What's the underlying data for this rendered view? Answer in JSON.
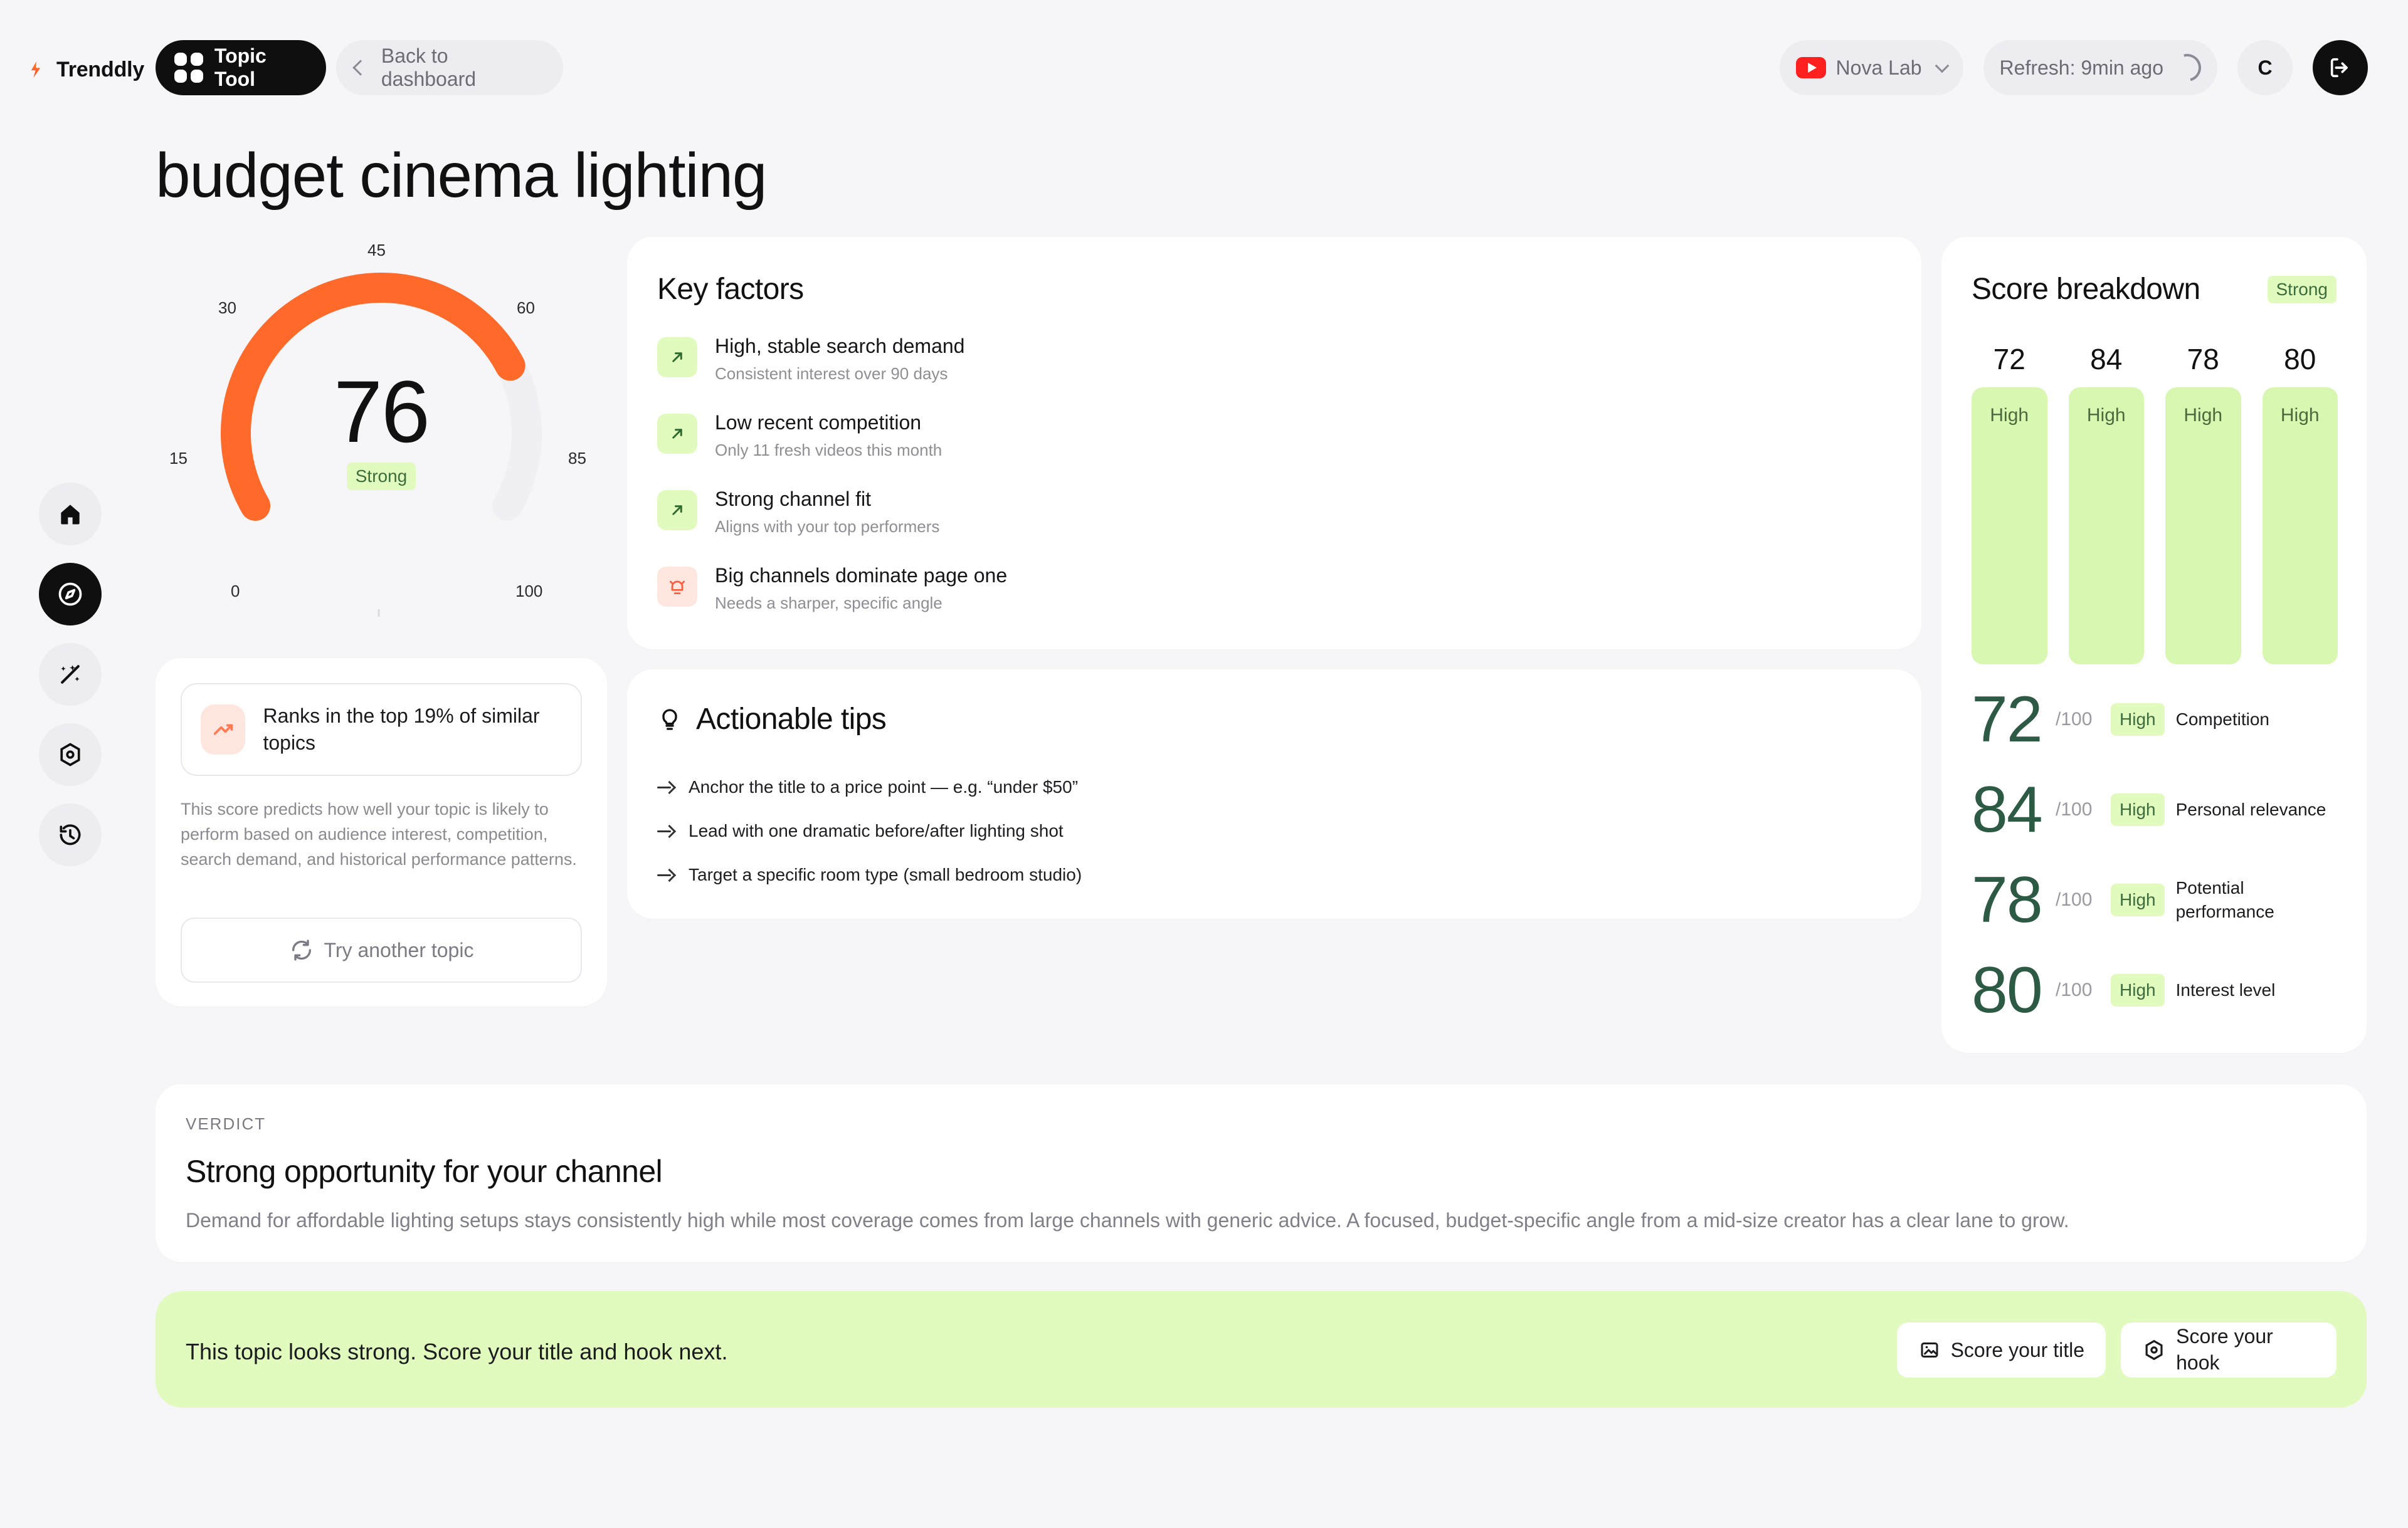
{
  "topbar": {
    "brand": "Trenddly",
    "tool_label": "Topic Tool",
    "back_label": "Back to dashboard",
    "channel": "Nova Lab",
    "refresh": "Refresh: 9min ago",
    "avatar_initial": "C"
  },
  "page": {
    "title": "budget cinema lighting"
  },
  "gauge": {
    "value": 76,
    "badge": "Strong",
    "ticks": [
      "0",
      "15",
      "30",
      "45",
      "60",
      "85",
      "100"
    ],
    "accent": "#ff6a2b"
  },
  "rank": {
    "headline": "Ranks in the top 19% of similar topics",
    "description": "This score predicts how well your topic is likely to perform based on audience interest, competition, search demand, and historical performance patterns.",
    "button": "Try another topic"
  },
  "key_factors": {
    "title": "Key factors",
    "items": [
      {
        "title": "High, stable search demand",
        "subtitle": "Consistent interest over 90 days",
        "icon": "arrow-up-right-icon",
        "tone": "green"
      },
      {
        "title": "Low recent competition",
        "subtitle": "Only 11 fresh videos this month",
        "icon": "arrow-up-right-icon",
        "tone": "green"
      },
      {
        "title": "Strong channel fit",
        "subtitle": "Aligns with your top performers",
        "icon": "arrow-up-right-icon",
        "tone": "green"
      },
      {
        "title": "Big channels dominate page one",
        "subtitle": "Needs a sharper, specific angle",
        "icon": "alarm-icon",
        "tone": "red"
      }
    ]
  },
  "tips": {
    "title": "Actionable tips",
    "items": [
      "Anchor the title to a price point — e.g. “under $50”",
      "Lead with one dramatic before/after lighting shot",
      "Target a specific room type (small bedroom studio)"
    ]
  },
  "score_breakdown": {
    "title": "Score breakdown",
    "badge": "Strong",
    "bars": [
      {
        "value": "72",
        "level": "High"
      },
      {
        "value": "84",
        "level": "High"
      },
      {
        "value": "78",
        "level": "High"
      },
      {
        "value": "80",
        "level": "High"
      }
    ],
    "rows": [
      {
        "value": "72",
        "out_of": "/100",
        "level": "High",
        "label": "Competition"
      },
      {
        "value": "84",
        "out_of": "/100",
        "level": "High",
        "label": "Personal relevance"
      },
      {
        "value": "78",
        "out_of": "/100",
        "level": "High",
        "label": "Potential performance"
      },
      {
        "value": "80",
        "out_of": "/100",
        "level": "High",
        "label": "Interest level"
      }
    ]
  },
  "verdict": {
    "kicker": "VERDICT",
    "title": "Strong opportunity for your channel",
    "text": "Demand for affordable lighting setups stays consistently high while most coverage comes from large channels with generic advice. A focused, budget-specific angle from a mid-size creator has a clear lane to grow."
  },
  "cta": {
    "text": "This topic looks strong. Score your title and hook next.",
    "button_title": "Score your title",
    "button_hook": "Score your hook"
  }
}
